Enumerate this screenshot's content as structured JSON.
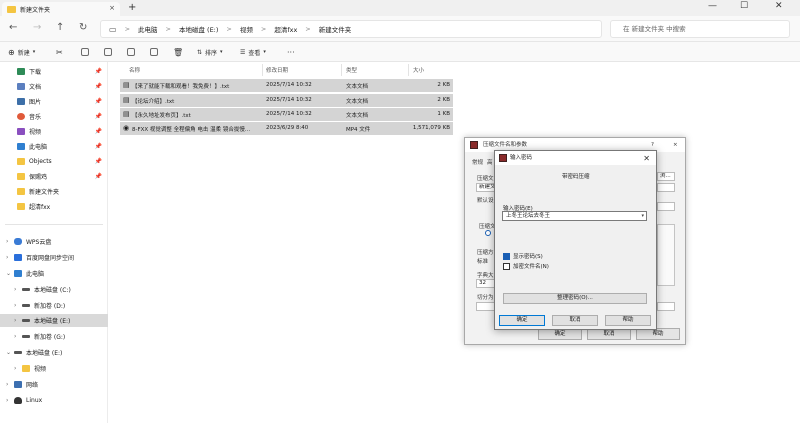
{
  "window": {
    "tab_title": "新建文件夹",
    "tab_close": "×",
    "new_tab": "+",
    "minimize": "—",
    "maximize": "☐",
    "close": "✕"
  },
  "address": {
    "crumbs": [
      "此电脑",
      "本地磁盘 (E:)",
      "视频",
      "超清fxx",
      "新建文件夹"
    ],
    "separator": ">",
    "search_placeholder": "在 新建文件夹 中搜索"
  },
  "toolbar": {
    "new_label": "新建",
    "sort_label": "排序",
    "view_label": "查看",
    "more_label": "···"
  },
  "sidebar": {
    "quick": [
      {
        "label": "下载",
        "icon": "download-icon"
      },
      {
        "label": "文档",
        "icon": "document-icon"
      },
      {
        "label": "图片",
        "icon": "picture-icon"
      },
      {
        "label": "音乐",
        "icon": "music-icon"
      },
      {
        "label": "视频",
        "icon": "video-icon"
      },
      {
        "label": "此电脑",
        "icon": "computer-icon"
      },
      {
        "label": "Objects",
        "icon": "folder-icon"
      },
      {
        "label": "保赐鸡",
        "icon": "folder-icon"
      },
      {
        "label": "新建文件夹",
        "icon": "folder-icon"
      },
      {
        "label": "超清fxx",
        "icon": "folder-icon"
      }
    ],
    "pin": "📌",
    "tree": [
      {
        "label": "WPS云盘"
      },
      {
        "label": "百度网盘同步空间"
      },
      {
        "label": "此电脑"
      },
      {
        "label": "本地磁盘 (C:)"
      },
      {
        "label": "新加卷 (D:)"
      },
      {
        "label": "本地磁盘 (E:)"
      },
      {
        "label": "新加卷 (G:)"
      },
      {
        "label": "本地磁盘 (E:)"
      },
      {
        "label": "视频"
      },
      {
        "label": "网络"
      },
      {
        "label": "Linux"
      }
    ]
  },
  "columns": {
    "name": "名称",
    "modified": "修改日期",
    "type": "类型",
    "size": "大小"
  },
  "files": [
    {
      "name": "【来了就能下载和观看！我免费！】.txt",
      "date": "2025/7/14 10:32",
      "type": "文本文档",
      "size": "2 KB"
    },
    {
      "name": "【论坛介绍】.txt",
      "date": "2025/7/14 10:32",
      "type": "文本文档",
      "size": "2 KB"
    },
    {
      "name": "【永久地址发布页】.txt",
      "date": "2025/7/14 10:32",
      "type": "文本文档",
      "size": "1 KB"
    },
    {
      "name": "8-FXX 视觉调整 全程偏角 电击 温柔 镜合拢慢...",
      "date": "2023/6/29 8:40",
      "type": "MP4 文件",
      "size": "1,571,079 KB"
    }
  ],
  "archive_dialog": {
    "title": "压缩文件名和参数",
    "help_q": "?",
    "close": "×",
    "tab_general": "常规",
    "tab_advanced": "高",
    "archive_label": "压缩文",
    "archive_value": "新建文",
    "default_label": "默认设",
    "format_label": "压缩文",
    "method_label": "压缩方",
    "method_value": "标准",
    "dict_label": "字典大",
    "dict_value": "32",
    "split_label": "切分为",
    "browse": "浏...",
    "ok": "确定",
    "cancel": "取消",
    "help": "帮助"
  },
  "password_dialog": {
    "title": "输入密码",
    "close": "✕",
    "heading": "带密码压缩",
    "input_label": "输入密码(E)",
    "input_value": "上冬王论坛去冬王",
    "show_password": "显示密码(S)",
    "show_password_checked": true,
    "encrypt_names": "加密文件名(N)",
    "encrypt_names_checked": false,
    "organize": "整理密码(O)...",
    "ok": "确定",
    "cancel": "取消",
    "help": "帮助"
  }
}
